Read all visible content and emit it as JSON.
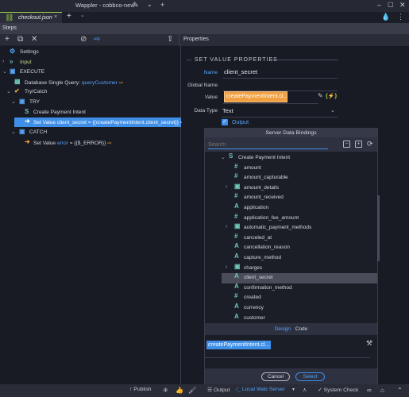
{
  "window": {
    "title": "Wappler - cobbco-new",
    "icons": [
      "pencil-icon",
      "chevron-down-icon",
      "plus-icon",
      "minimize-icon",
      "maximize-icon",
      "close-icon"
    ]
  },
  "tabs": {
    "active": {
      "label": "checkout.json",
      "close": "×"
    },
    "add": "+",
    "dropdown": "⌄"
  },
  "steps_panel": {
    "title": "Steps",
    "toolbar": [
      "add-icon",
      "copy-icon",
      "delete-icon",
      "disable-icon",
      "step-out-icon"
    ],
    "tree": [
      {
        "label": "Settings",
        "icon": "⚙",
        "icon_name": "gear-icon",
        "indent": 1,
        "chevron": ""
      },
      {
        "label": "Input",
        "icon": "»",
        "icon_name": "input-icon",
        "indent": 1,
        "chevron": "›"
      },
      {
        "label": "EXECUTE",
        "icon": "▣",
        "icon_name": "box-icon",
        "indent": 1,
        "chevron": "⌄"
      },
      {
        "label": "Database Single Query: ",
        "extra": "queryCustomer",
        "icon": "▦",
        "icon_name": "database-icon",
        "indent": 2,
        "chevron": "",
        "out": true
      },
      {
        "label": "Try/Catch",
        "icon": "✔",
        "icon_name": "trycatch-icon",
        "indent": 2,
        "chevron": "⌄"
      },
      {
        "label": "TRY",
        "icon": "▣",
        "icon_name": "box-icon",
        "indent": 3,
        "chevron": "⌄"
      },
      {
        "label": "Create Payment Intent",
        "icon": "S",
        "icon_name": "stripe-icon",
        "indent": 4,
        "chevron": ""
      },
      {
        "label": "Set Value client_secret = {{createPaymentIntent.client_secret}}",
        "icon": "➜",
        "icon_name": "set-value-icon",
        "indent": 4,
        "chevron": "",
        "selected": true,
        "out": true
      },
      {
        "label": "CATCH",
        "icon": "▣",
        "icon_name": "box-icon",
        "indent": 3,
        "chevron": "⌄"
      },
      {
        "label": "Set Value ",
        "extra": "error",
        "tail": " = {{$_ERROR}}",
        "icon": "➜",
        "icon_name": "set-value-icon",
        "indent": 4,
        "chevron": "",
        "out": true
      }
    ]
  },
  "properties": {
    "title": "Properties",
    "section": "SET VALUE PROPERTIES",
    "name_label": "Name",
    "name_value": "client_secret",
    "global_name_label": "Global Name",
    "global_name_value": "",
    "value_label": "Value",
    "value_value": "createPaymentIntent.cl...",
    "data_type_label": "Data Type",
    "data_type_value": "Text",
    "output_label": "Output",
    "output_checked": true
  },
  "bindings_dialog": {
    "title": "Server Data Bindings",
    "search_placeholder": "Search",
    "parent": {
      "label": "Create Payment Intent",
      "icon": "S"
    },
    "items": [
      {
        "label": "amount",
        "icon": "#",
        "icon_name": "number-icon",
        "expandable": false
      },
      {
        "label": "amount_capturable",
        "icon": "#",
        "icon_name": "number-icon",
        "expandable": false
      },
      {
        "label": "amount_details",
        "icon": "▣",
        "icon_name": "object-icon",
        "expandable": true
      },
      {
        "label": "amount_received",
        "icon": "#",
        "icon_name": "number-icon",
        "expandable": false
      },
      {
        "label": "application",
        "icon": "A",
        "icon_name": "text-icon",
        "expandable": false
      },
      {
        "label": "application_fee_amount",
        "icon": "#",
        "icon_name": "number-icon",
        "expandable": false
      },
      {
        "label": "automatic_payment_methods",
        "icon": "▣",
        "icon_name": "object-icon",
        "expandable": true
      },
      {
        "label": "canceled_at",
        "icon": "#",
        "icon_name": "number-icon",
        "expandable": false
      },
      {
        "label": "cancellation_reason",
        "icon": "A",
        "icon_name": "text-icon",
        "expandable": false
      },
      {
        "label": "capture_method",
        "icon": "A",
        "icon_name": "text-icon",
        "expandable": false
      },
      {
        "label": "charges",
        "icon": "▣",
        "icon_name": "object-icon",
        "expandable": true
      },
      {
        "label": "client_secret",
        "icon": "A",
        "icon_name": "text-icon",
        "expandable": false,
        "selected": true
      },
      {
        "label": "confirmation_method",
        "icon": "A",
        "icon_name": "text-icon",
        "expandable": false
      },
      {
        "label": "created",
        "icon": "#",
        "icon_name": "number-icon",
        "expandable": false
      },
      {
        "label": "currency",
        "icon": "A",
        "icon_name": "text-icon",
        "expandable": false
      },
      {
        "label": "customer",
        "icon": "A",
        "icon_name": "text-icon",
        "expandable": false
      }
    ],
    "tabs": [
      "Design",
      "Code"
    ],
    "active_tab": "Design",
    "expression_chip": "createPaymentIntent.cl...",
    "cancel_label": "Cancel",
    "select_label": "Select"
  },
  "statusbar": {
    "publish": "Publish",
    "output": "Output",
    "server": "Local Web Server",
    "system_check": "System Check"
  },
  "colors": {
    "accent": "#3f8fe8",
    "value_highlight": "#f0a040",
    "brand_green": "#9bd34a",
    "teal_icon": "#6fc7b5"
  }
}
